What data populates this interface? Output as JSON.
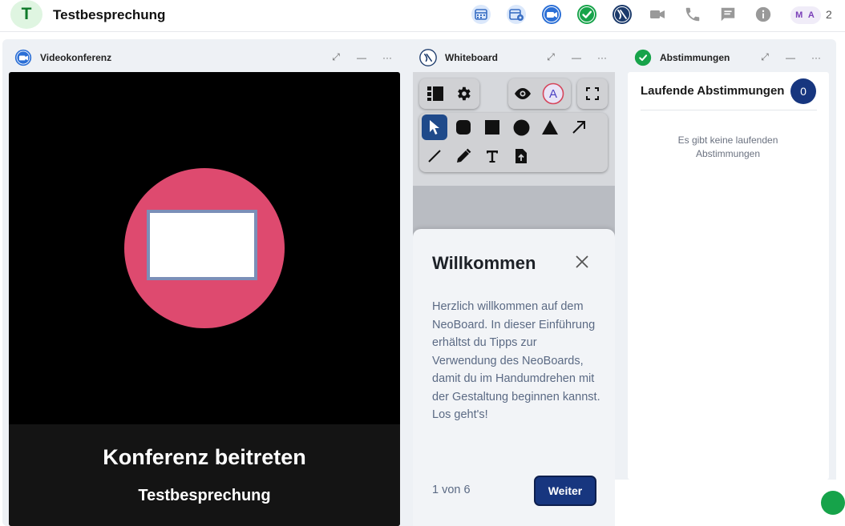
{
  "room": {
    "avatar_letter": "T",
    "title": "Testbesprechung"
  },
  "toolbar_icons": [
    "calendar-icon",
    "calendar-settings-icon",
    "video-widget-icon",
    "poll-widget-icon",
    "whiteboard-widget-icon",
    "video-camera-icon",
    "phone-icon",
    "chat-icon",
    "info-icon"
  ],
  "members": {
    "initials": "M A",
    "count": "2"
  },
  "widgets": {
    "video": {
      "title": "Videokonferenz",
      "join_title": "Konferenz beitreten",
      "join_subtitle": "Testbesprechung"
    },
    "whiteboard": {
      "title": "Whiteboard",
      "presenter_letter": "A",
      "dialog": {
        "title": "Willkommen",
        "body": "Herzlich willkommen auf dem NeoBoard. In dieser Einführung erhältst du Tipps zur Verwendung des NeoBoards, damit du im Handumdrehen mit der Gestaltung beginnen kannst. Los geht's!",
        "step": "1 von 6",
        "next_label": "Weiter"
      }
    },
    "polls": {
      "title": "Abstimmungen",
      "heading": "Laufende Abstimmungen",
      "count": "0",
      "empty_text": "Es gibt keine laufenden Abstimmungen"
    }
  },
  "colors": {
    "accent": "#17367f",
    "video_circle": "#de4a6f",
    "poll_green": "#16a34a",
    "workspace_bg": "#eef1f5"
  }
}
